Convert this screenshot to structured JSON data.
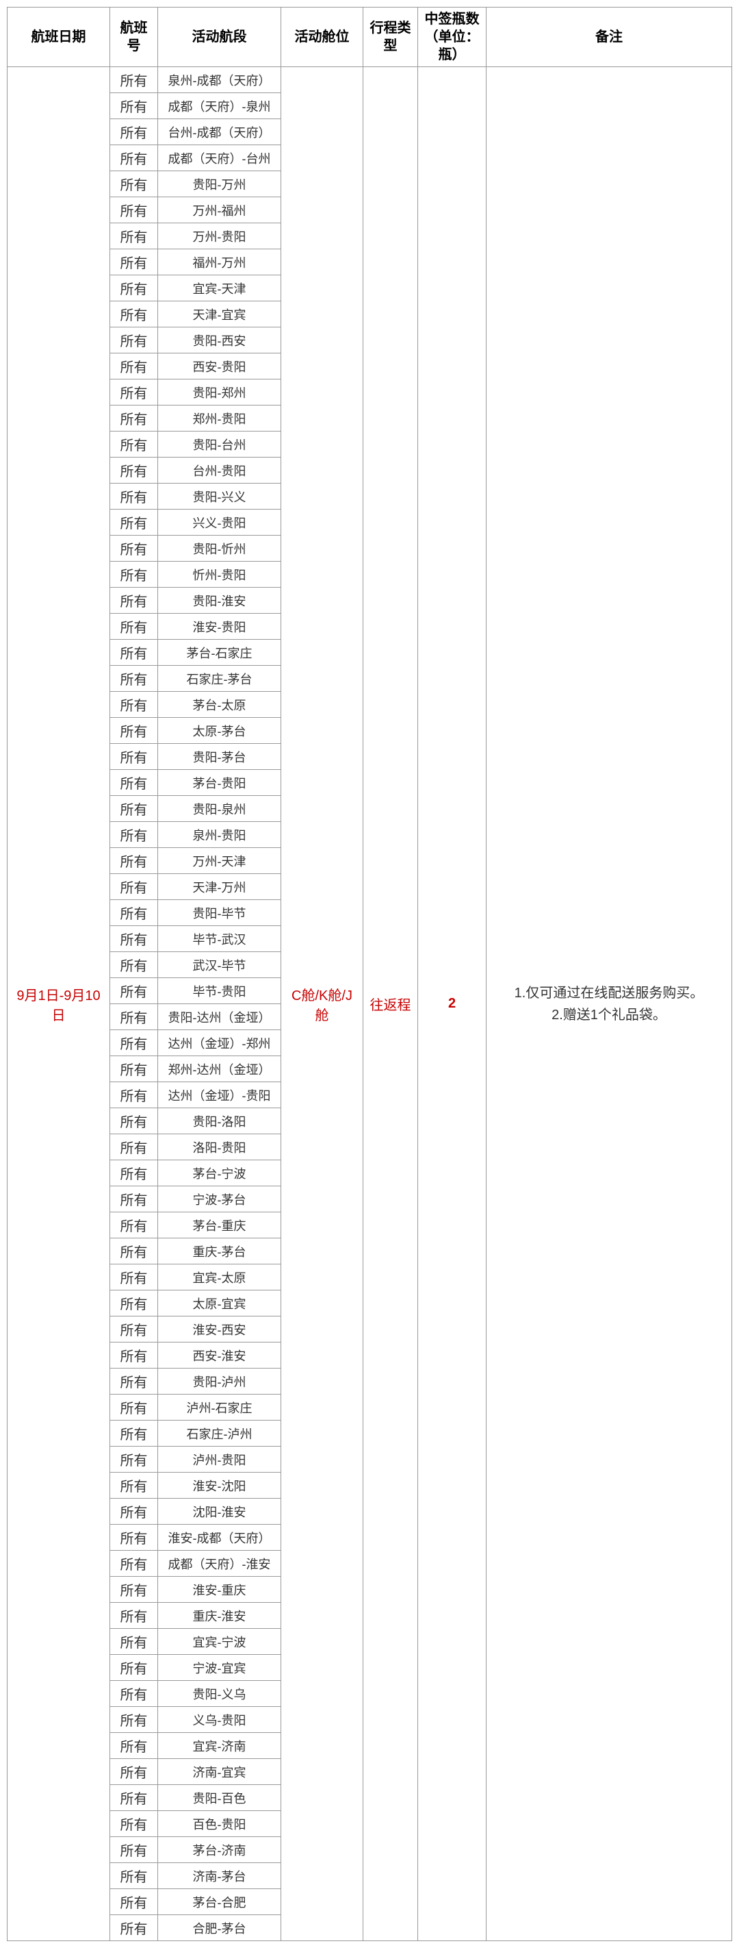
{
  "headers": {
    "date": "航班日期",
    "flight_no": "航班号",
    "segment": "活动航段",
    "cabin": "活动舱位",
    "trip_type": "行程类型",
    "qty": "中签瓶数（单位：瓶）",
    "remark": "备注"
  },
  "merged": {
    "date": "9月1日-9月10日",
    "cabin": "C舱/K舱/J舱",
    "trip_type": "往返程",
    "qty": "2",
    "remark_line1": "1.仅可通过在线配送服务购买。",
    "remark_line2": "2.赠送1个礼品袋。"
  },
  "rows": [
    {
      "fno": "所有",
      "seg": "泉州-成都（天府）"
    },
    {
      "fno": "所有",
      "seg": "成都（天府）-泉州"
    },
    {
      "fno": "所有",
      "seg": "台州-成都（天府）"
    },
    {
      "fno": "所有",
      "seg": "成都（天府）-台州"
    },
    {
      "fno": "所有",
      "seg": "贵阳-万州"
    },
    {
      "fno": "所有",
      "seg": "万州-福州"
    },
    {
      "fno": "所有",
      "seg": "万州-贵阳"
    },
    {
      "fno": "所有",
      "seg": "福州-万州"
    },
    {
      "fno": "所有",
      "seg": "宜宾-天津"
    },
    {
      "fno": "所有",
      "seg": "天津-宜宾"
    },
    {
      "fno": "所有",
      "seg": "贵阳-西安"
    },
    {
      "fno": "所有",
      "seg": "西安-贵阳"
    },
    {
      "fno": "所有",
      "seg": "贵阳-郑州"
    },
    {
      "fno": "所有",
      "seg": "郑州-贵阳"
    },
    {
      "fno": "所有",
      "seg": "贵阳-台州"
    },
    {
      "fno": "所有",
      "seg": "台州-贵阳"
    },
    {
      "fno": "所有",
      "seg": "贵阳-兴义"
    },
    {
      "fno": "所有",
      "seg": "兴义-贵阳"
    },
    {
      "fno": "所有",
      "seg": "贵阳-忻州"
    },
    {
      "fno": "所有",
      "seg": "忻州-贵阳"
    },
    {
      "fno": "所有",
      "seg": "贵阳-淮安"
    },
    {
      "fno": "所有",
      "seg": "淮安-贵阳"
    },
    {
      "fno": "所有",
      "seg": "茅台-石家庄"
    },
    {
      "fno": "所有",
      "seg": "石家庄-茅台"
    },
    {
      "fno": "所有",
      "seg": "茅台-太原"
    },
    {
      "fno": "所有",
      "seg": "太原-茅台"
    },
    {
      "fno": "所有",
      "seg": "贵阳-茅台"
    },
    {
      "fno": "所有",
      "seg": "茅台-贵阳"
    },
    {
      "fno": "所有",
      "seg": "贵阳-泉州"
    },
    {
      "fno": "所有",
      "seg": "泉州-贵阳"
    },
    {
      "fno": "所有",
      "seg": "万州-天津"
    },
    {
      "fno": "所有",
      "seg": "天津-万州"
    },
    {
      "fno": "所有",
      "seg": "贵阳-毕节"
    },
    {
      "fno": "所有",
      "seg": "毕节-武汉"
    },
    {
      "fno": "所有",
      "seg": "武汉-毕节"
    },
    {
      "fno": "所有",
      "seg": "毕节-贵阳"
    },
    {
      "fno": "所有",
      "seg": "贵阳-达州（金垭）"
    },
    {
      "fno": "所有",
      "seg": "达州（金垭）-郑州"
    },
    {
      "fno": "所有",
      "seg": "郑州-达州（金垭）"
    },
    {
      "fno": "所有",
      "seg": "达州（金垭）-贵阳"
    },
    {
      "fno": "所有",
      "seg": "贵阳-洛阳"
    },
    {
      "fno": "所有",
      "seg": "洛阳-贵阳"
    },
    {
      "fno": "所有",
      "seg": "茅台-宁波"
    },
    {
      "fno": "所有",
      "seg": "宁波-茅台"
    },
    {
      "fno": "所有",
      "seg": "茅台-重庆"
    },
    {
      "fno": "所有",
      "seg": "重庆-茅台"
    },
    {
      "fno": "所有",
      "seg": "宜宾-太原"
    },
    {
      "fno": "所有",
      "seg": "太原-宜宾"
    },
    {
      "fno": "所有",
      "seg": "淮安-西安"
    },
    {
      "fno": "所有",
      "seg": "西安-淮安"
    },
    {
      "fno": "所有",
      "seg": "贵阳-泸州"
    },
    {
      "fno": "所有",
      "seg": "泸州-石家庄"
    },
    {
      "fno": "所有",
      "seg": "石家庄-泸州"
    },
    {
      "fno": "所有",
      "seg": "泸州-贵阳"
    },
    {
      "fno": "所有",
      "seg": "淮安-沈阳"
    },
    {
      "fno": "所有",
      "seg": "沈阳-淮安"
    },
    {
      "fno": "所有",
      "seg": "淮安-成都（天府）"
    },
    {
      "fno": "所有",
      "seg": "成都（天府）-淮安"
    },
    {
      "fno": "所有",
      "seg": "淮安-重庆"
    },
    {
      "fno": "所有",
      "seg": "重庆-淮安"
    },
    {
      "fno": "所有",
      "seg": "宜宾-宁波"
    },
    {
      "fno": "所有",
      "seg": "宁波-宜宾"
    },
    {
      "fno": "所有",
      "seg": "贵阳-义乌"
    },
    {
      "fno": "所有",
      "seg": "义乌-贵阳"
    },
    {
      "fno": "所有",
      "seg": "宜宾-济南"
    },
    {
      "fno": "所有",
      "seg": "济南-宜宾"
    },
    {
      "fno": "所有",
      "seg": "贵阳-百色"
    },
    {
      "fno": "所有",
      "seg": "百色-贵阳"
    },
    {
      "fno": "所有",
      "seg": "茅台-济南"
    },
    {
      "fno": "所有",
      "seg": "济南-茅台"
    },
    {
      "fno": "所有",
      "seg": "茅台-合肥"
    },
    {
      "fno": "所有",
      "seg": "合肥-茅台"
    }
  ]
}
